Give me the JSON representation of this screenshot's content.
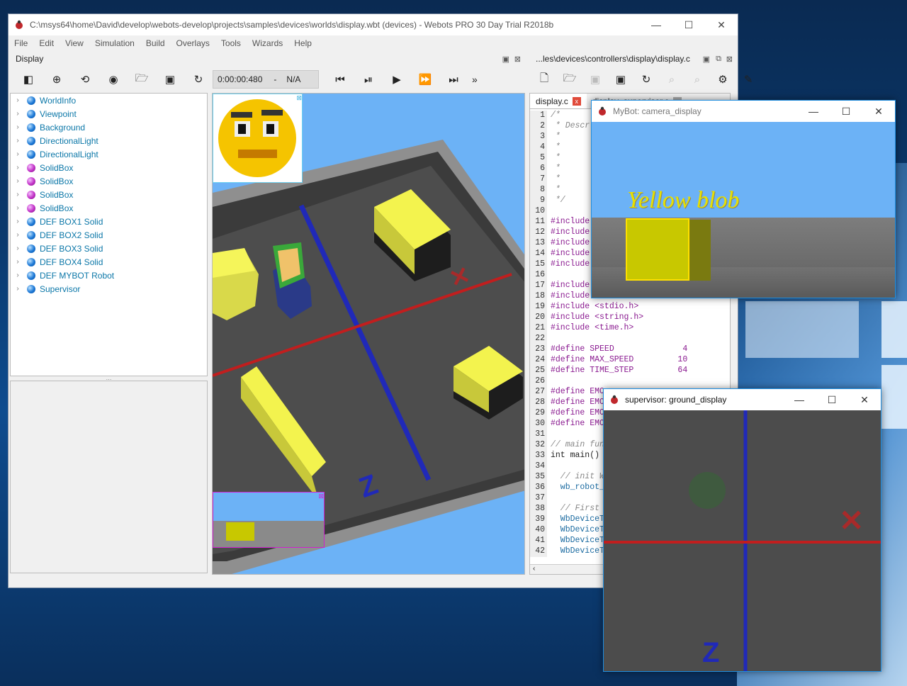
{
  "main_window": {
    "title": "C:\\msys64\\home\\David\\develop\\webots-develop\\projects\\samples\\devices\\worlds\\display.wbt (devices) - Webots PRO 30 Day Trial R2018b",
    "menu": [
      "File",
      "Edit",
      "View",
      "Simulation",
      "Build",
      "Overlays",
      "Tools",
      "Wizards",
      "Help"
    ]
  },
  "display_dock": {
    "title": "Display"
  },
  "editor_dock": {
    "title": "...les\\devices\\controllers\\display\\display.c"
  },
  "toolbar": {
    "time": "0:00:00:480",
    "separator": "-",
    "fps": "N/A",
    "more": "»"
  },
  "scene_tree": [
    {
      "label": "WorldInfo",
      "color": "blue"
    },
    {
      "label": "Viewpoint",
      "color": "blue"
    },
    {
      "label": "Background",
      "color": "blue"
    },
    {
      "label": "DirectionalLight",
      "color": "blue"
    },
    {
      "label": "DirectionalLight",
      "color": "blue"
    },
    {
      "label": "SolidBox",
      "color": "purple"
    },
    {
      "label": "SolidBox",
      "color": "purple"
    },
    {
      "label": "SolidBox",
      "color": "purple"
    },
    {
      "label": "SolidBox",
      "color": "purple"
    },
    {
      "label": "DEF BOX1 Solid",
      "color": "blue"
    },
    {
      "label": "DEF BOX2 Solid",
      "color": "blue"
    },
    {
      "label": "DEF BOX3 Solid",
      "color": "blue"
    },
    {
      "label": "DEF BOX4 Solid",
      "color": "blue"
    },
    {
      "label": "DEF MYBOT Robot",
      "color": "blue"
    },
    {
      "label": "Supervisor",
      "color": "blue"
    }
  ],
  "editor_tabs": [
    {
      "label": "display.c",
      "close": "x"
    },
    {
      "label": "display_supervisor.c",
      "close": "x"
    }
  ],
  "code_lines": [
    {
      "n": "1",
      "t": "/*",
      "c": "cmt"
    },
    {
      "n": "2",
      "t": " * Descr",
      "c": "cmt"
    },
    {
      "n": "3",
      "t": " *",
      "c": "cmt"
    },
    {
      "n": "4",
      "t": " *",
      "c": "cmt"
    },
    {
      "n": "5",
      "t": " *",
      "c": "cmt"
    },
    {
      "n": "6",
      "t": " *",
      "c": "cmt"
    },
    {
      "n": "7",
      "t": " *",
      "c": "cmt"
    },
    {
      "n": "8",
      "t": " *",
      "c": "cmt"
    },
    {
      "n": "9",
      "t": " */",
      "c": "cmt"
    },
    {
      "n": "10",
      "t": "",
      "c": ""
    },
    {
      "n": "11",
      "t": "#include",
      "c": "kw"
    },
    {
      "n": "12",
      "t": "#include",
      "c": "kw"
    },
    {
      "n": "13",
      "t": "#include",
      "c": "kw"
    },
    {
      "n": "14",
      "t": "#include",
      "c": "kw"
    },
    {
      "n": "15",
      "t": "#include",
      "c": "kw"
    },
    {
      "n": "16",
      "t": "",
      "c": ""
    },
    {
      "n": "17",
      "t": "#include",
      "c": "kw"
    },
    {
      "n": "18",
      "t": "#include <stdlib.h>",
      "c": "kw"
    },
    {
      "n": "19",
      "t": "#include <stdio.h>",
      "c": "kw"
    },
    {
      "n": "20",
      "t": "#include <string.h>",
      "c": "kw"
    },
    {
      "n": "21",
      "t": "#include <time.h>",
      "c": "kw"
    },
    {
      "n": "22",
      "t": "",
      "c": ""
    },
    {
      "n": "23",
      "t": "#define SPEED              4",
      "c": "kw"
    },
    {
      "n": "24",
      "t": "#define MAX_SPEED         10",
      "c": "kw"
    },
    {
      "n": "25",
      "t": "#define TIME_STEP         64",
      "c": "kw"
    },
    {
      "n": "26",
      "t": "",
      "c": ""
    },
    {
      "n": "27",
      "t": "#define EMO",
      "c": "kw"
    },
    {
      "n": "28",
      "t": "#define EMO",
      "c": "kw"
    },
    {
      "n": "29",
      "t": "#define EMO",
      "c": "kw"
    },
    {
      "n": "30",
      "t": "#define EMO",
      "c": "kw"
    },
    {
      "n": "31",
      "t": "",
      "c": ""
    },
    {
      "n": "32",
      "t": "// main fun",
      "c": "cmt"
    },
    {
      "n": "33",
      "t": "int main()",
      "c": ""
    },
    {
      "n": "34",
      "t": "",
      "c": ""
    },
    {
      "n": "35",
      "t": "  // init W",
      "c": "cmt"
    },
    {
      "n": "36",
      "t": "  wb_robot_",
      "c": "str"
    },
    {
      "n": "37",
      "t": "",
      "c": ""
    },
    {
      "n": "38",
      "t": "  // First",
      "c": "cmt"
    },
    {
      "n": "39",
      "t": "  WbDeviceT",
      "c": "str"
    },
    {
      "n": "40",
      "t": "  WbDeviceT",
      "c": "str"
    },
    {
      "n": "41",
      "t": "  WbDeviceT",
      "c": "str"
    },
    {
      "n": "42",
      "t": "  WbDeviceT",
      "c": "str"
    }
  ],
  "camera_window": {
    "title": "MyBot: camera_display",
    "overlay_text": "Yellow blob"
  },
  "ground_window": {
    "title": "supervisor: ground_display"
  },
  "controls": {
    "minimize": "—",
    "maximize": "☐",
    "close": "✕"
  }
}
